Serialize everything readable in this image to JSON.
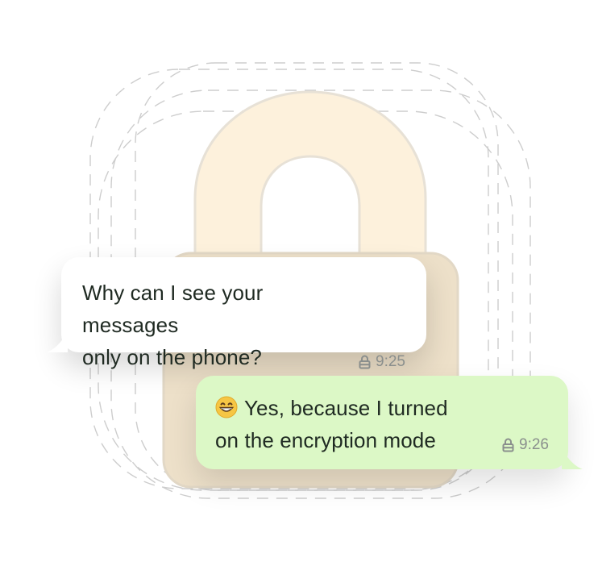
{
  "colors": {
    "lock_body": "#ede0c9",
    "lock_shackle": "#fdf1dc",
    "incoming_bubble": "#ffffff",
    "outgoing_bubble": "#dcf8c6",
    "timestamp": "#8a8f8d"
  },
  "messages": [
    {
      "text": "Why can I see your messages\nonly on the phone?",
      "time": "9:25",
      "icon": "lock-icon",
      "direction": "incoming"
    },
    {
      "emoji": "grinning-face-emoji",
      "text": "Yes, because I turned\non the encryption mode",
      "time": "9:26",
      "icon": "lock-icon",
      "direction": "outgoing"
    }
  ]
}
